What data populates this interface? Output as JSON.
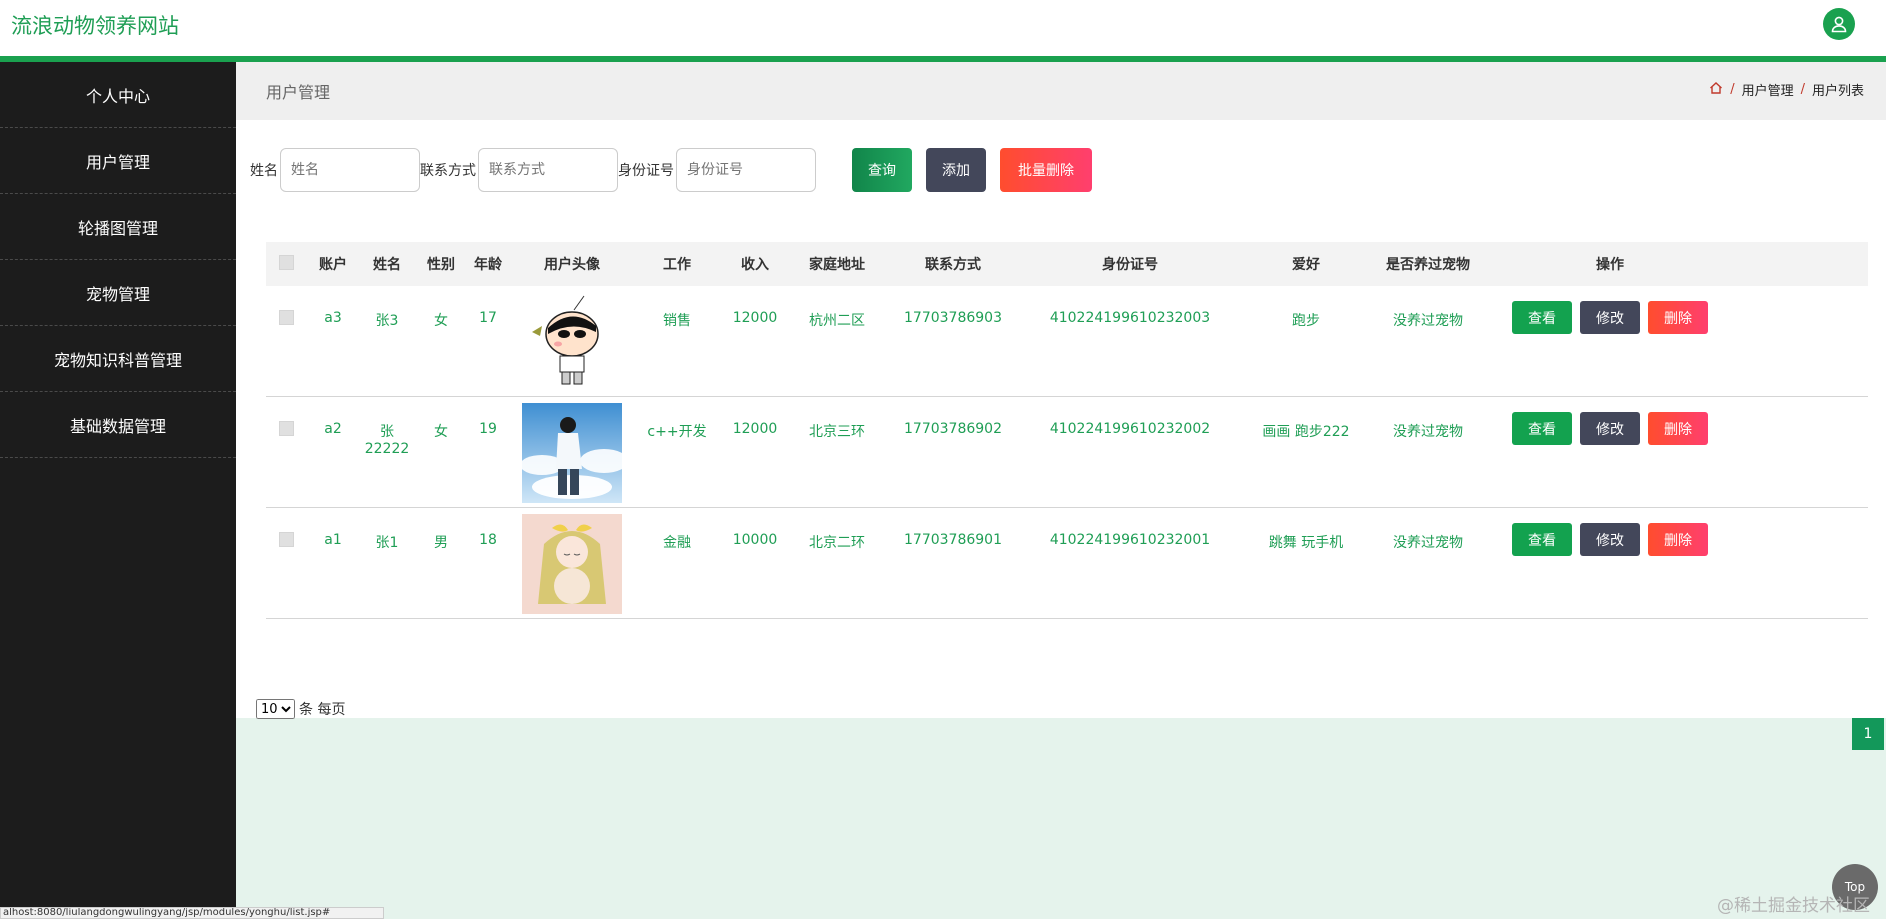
{
  "header": {
    "site_title": "流浪动物领养网站"
  },
  "sidebar": {
    "items": [
      {
        "label": "个人中心"
      },
      {
        "label": "用户管理"
      },
      {
        "label": "轮播图管理"
      },
      {
        "label": "宠物管理"
      },
      {
        "label": "宠物知识科普管理"
      },
      {
        "label": "基础数据管理"
      }
    ]
  },
  "page": {
    "title": "用户管理",
    "breadcrumb": [
      "用户管理",
      "用户列表"
    ],
    "breadcrumb_sep": "/"
  },
  "search": {
    "name_label": "姓名",
    "name_placeholder": "姓名",
    "phone_label": "联系方式",
    "phone_placeholder": "联系方式",
    "id_label": "身份证号",
    "id_placeholder": "身份证号",
    "query_label": "查询",
    "add_label": "添加",
    "batch_delete_label": "批量删除"
  },
  "table": {
    "headers": [
      "账户",
      "姓名",
      "性别",
      "年龄",
      "用户头像",
      "工作",
      "收入",
      "家庭地址",
      "联系方式",
      "身份证号",
      "爱好",
      "是否养过宠物",
      "操作"
    ],
    "rows": [
      {
        "account": "a3",
        "name": "张3",
        "gender": "女",
        "age": "17",
        "job": "销售",
        "income": "12000",
        "address": "杭州二区",
        "phone": "17703786903",
        "id_no": "410224199610232003",
        "hobby": "跑步",
        "pet": "没养过宠物"
      },
      {
        "account": "a2",
        "name": "张22222",
        "gender": "女",
        "age": "19",
        "job": "c++开发",
        "income": "12000",
        "address": "北京三环",
        "phone": "17703786902",
        "id_no": "410224199610232002",
        "hobby": "画画 跑步222",
        "pet": "没养过宠物"
      },
      {
        "account": "a1",
        "name": "张1",
        "gender": "男",
        "age": "18",
        "job": "金融",
        "income": "10000",
        "address": "北京二环",
        "phone": "17703786901",
        "id_no": "410224199610232001",
        "hobby": "跳舞 玩手机",
        "pet": "没养过宠物"
      }
    ],
    "op_view": "查看",
    "op_edit": "修改",
    "op_delete": "删除"
  },
  "pager": {
    "page_size": "10",
    "per_page_text": "条 每页",
    "current_page": "1"
  },
  "floating": {
    "top_label": "Top",
    "watermark": "@稀土掘金技术社区"
  },
  "status_bar": {
    "url": "alhost:8080/liulangdongwulingyang/jsp/modules/yonghu/list.jsp#"
  },
  "colors": {
    "brand_green": "#1aa14f",
    "sidebar_bg": "#1c1c1c",
    "danger": "#ff4560",
    "dark_btn": "#43475a"
  }
}
